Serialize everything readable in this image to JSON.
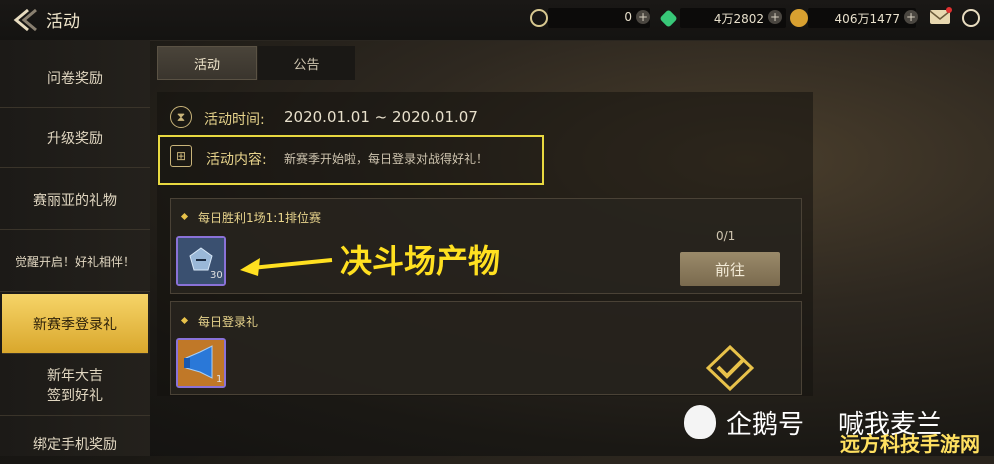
{
  "header": {
    "title": "活动",
    "resources": [
      {
        "icon": "moon-coin-icon",
        "value": "0",
        "color": "#d8c890"
      },
      {
        "icon": "green-gem-icon",
        "value": "4万2802",
        "color": "#38c878"
      },
      {
        "icon": "gold-coin-icon",
        "value": "406万1477",
        "color": "#d8a030"
      }
    ]
  },
  "sidebar": {
    "items": [
      {
        "label": "问卷奖励"
      },
      {
        "label": "升级奖励"
      },
      {
        "label": "赛丽亚的礼物"
      },
      {
        "label": "觉醒开启！好礼相伴！"
      },
      {
        "label": "新赛季登录礼",
        "active": true
      },
      {
        "label": "新年大吉\n签到好礼"
      },
      {
        "label": "绑定手机奖励"
      }
    ]
  },
  "tabs": [
    {
      "label": "活动",
      "active": true
    },
    {
      "label": "公告",
      "active": false
    }
  ],
  "info": {
    "time_label": "活动时间:",
    "time_value": "2020.01.01 ~ 2020.01.07",
    "content_label": "活动内容:",
    "content_value": "新赛季开始啦，每日登录对战得好礼！"
  },
  "tasks": [
    {
      "title": "每日胜利1场1:1排位赛",
      "item_count": "30",
      "progress": "0/1",
      "button": "前往"
    },
    {
      "title": "每日登录礼",
      "item_count": "1"
    }
  ],
  "annotation": "决斗场产物",
  "watermark": {
    "brand": "企鹅号",
    "author": "喊我麦兰"
  },
  "corner_watermark": "远方科技手游网"
}
